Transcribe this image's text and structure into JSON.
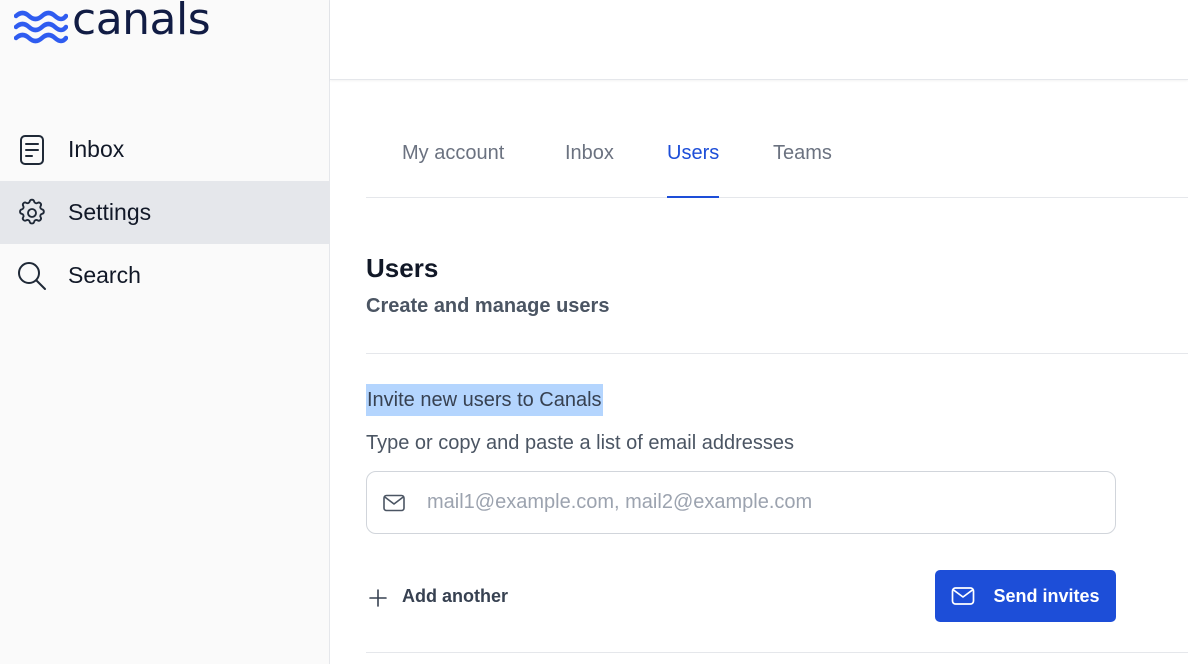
{
  "app": {
    "name": "canals",
    "accent": "#1d4ed8"
  },
  "sidebar": {
    "items": [
      {
        "label": "Inbox",
        "icon": "document-icon",
        "active": false
      },
      {
        "label": "Settings",
        "icon": "gear-icon",
        "active": true
      },
      {
        "label": "Search",
        "icon": "search-icon",
        "active": false
      }
    ]
  },
  "tabs": [
    {
      "label": "My account",
      "active": false
    },
    {
      "label": "Inbox",
      "active": false
    },
    {
      "label": "Users",
      "active": true
    },
    {
      "label": "Teams",
      "active": false
    }
  ],
  "section": {
    "title": "Users",
    "subtitle": "Create and manage users"
  },
  "invite": {
    "title": "Invite new users to Canals",
    "description": "Type or copy and paste a list of email addresses",
    "input_placeholder": "mail1@example.com, mail2@example.com",
    "input_value": "",
    "add_another_label": "Add another",
    "send_label": "Send invites"
  }
}
